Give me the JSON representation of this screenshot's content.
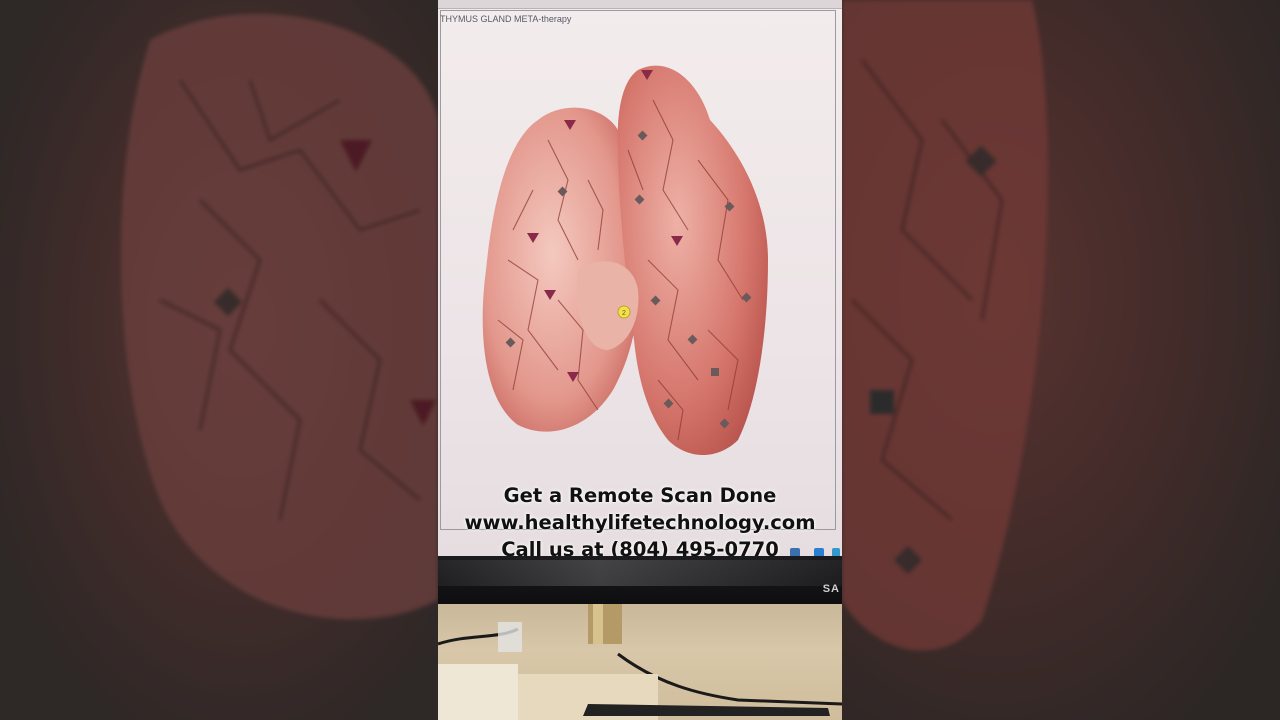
{
  "screen": {
    "window_title": "THYMUS GLAND META-therapy",
    "monitor_brand": "SA"
  },
  "caption": {
    "line1": "Get a Remote Scan Done",
    "line2": "www.healthylifetechnology.com",
    "line3": "Call us at (804) 495-0770"
  },
  "markers": {
    "highlighted_label": "2"
  },
  "colors": {
    "organ": "#e9a99e",
    "organ_dark": "#c9645c",
    "vein": "#8e3b36",
    "marker_triangle": "#8a2a4a",
    "marker_highlight": "#f2e14a",
    "caption_text": "#111111"
  }
}
